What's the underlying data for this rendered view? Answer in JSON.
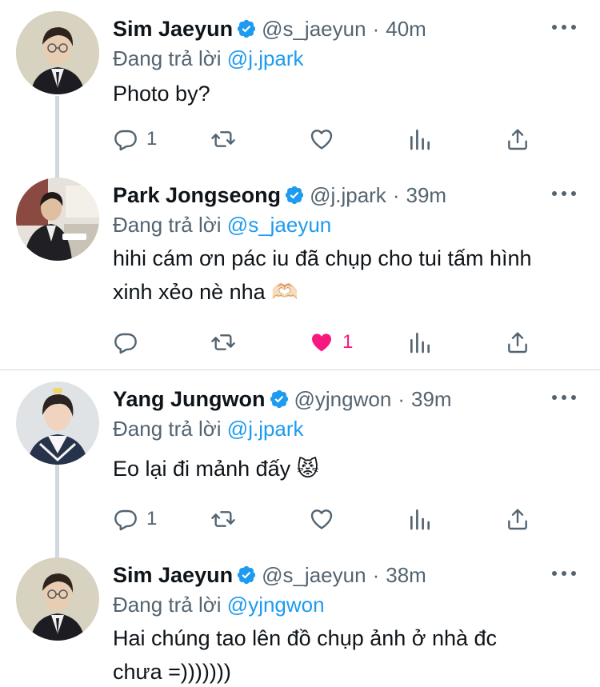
{
  "tweets": [
    {
      "name": "Sim Jaeyun",
      "handle": "@s_jaeyun",
      "time": "40m",
      "replying_label": "Đang trả lời",
      "replying_to": "@j.jpark",
      "text_lines": [
        "Photo by?"
      ],
      "reply_count": "1",
      "like_count": "",
      "liked": false
    },
    {
      "name": "Park Jongseong",
      "handle": "@j.jpark",
      "time": "39m",
      "replying_label": "Đang trả lời",
      "replying_to": "@s_jaeyun",
      "text_lines": [
        "hihi cám ơn pác iu đã chụp cho tui tấm hình",
        "xinh xẻo nè nha 🫶🏻"
      ],
      "reply_count": "",
      "like_count": "1",
      "liked": true
    },
    {
      "name": "Yang Jungwon",
      "handle": "@yjngwon",
      "time": "39m",
      "replying_label": "Đang trả lời",
      "replying_to": "@j.jpark",
      "text_lines": [
        "Eo lại đi mảnh đấy 😾"
      ],
      "reply_count": "1",
      "like_count": "",
      "liked": false
    },
    {
      "name": "Sim Jaeyun",
      "handle": "@s_jaeyun",
      "time": "38m",
      "replying_label": "Đang trả lời",
      "replying_to": "@yjngwon",
      "text_lines": [
        "Hai chúng tao lên đồ chụp ảnh ở nhà đc",
        "chưa =)))))))"
      ],
      "reply_count": "",
      "like_count": "",
      "liked": false
    }
  ],
  "colors": {
    "accent": "#1d9bf0",
    "muted": "#536471",
    "like": "#f91880",
    "divider": "#cfd9de"
  },
  "icons": [
    "verified-badge-icon",
    "more-icon",
    "reply-icon",
    "retweet-icon",
    "like-icon",
    "analytics-icon",
    "share-icon"
  ]
}
